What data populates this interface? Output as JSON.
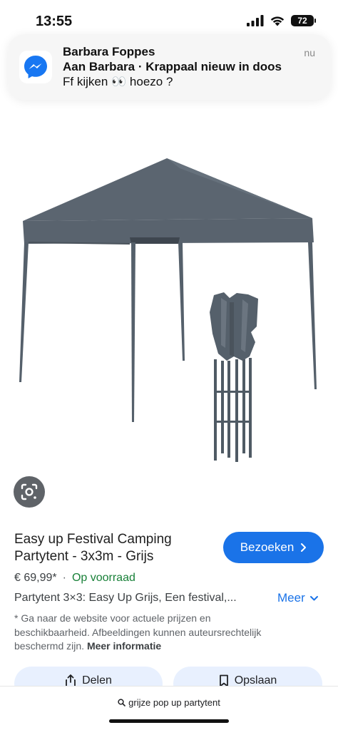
{
  "status_bar": {
    "time": "13:55",
    "battery": "72",
    "icons": [
      "signal-icon",
      "wifi-icon",
      "battery-icon"
    ]
  },
  "notification": {
    "app_icon": "messenger-icon",
    "sender": "Barbara Foppes",
    "subtitle": "Aan Barbara · Krappaal nieuw in doos",
    "message": "Ff kijken 👀 hoezo ?",
    "time": "nu"
  },
  "image": {
    "lens_icon": "google-lens-icon"
  },
  "product": {
    "title": "Easy up Festival Camping Partytent - 3x3m - Grijs",
    "visit_label": "Bezoeken",
    "price": "€ 69,99*",
    "separator": "·",
    "stock": "Op voorraad",
    "description": "Partytent 3×3: Easy Up Grijs, Een festival,...",
    "more_label": "Meer",
    "disclaimer": "* Ga naar de website voor actuele prijzen en beschikbaarheid. Afbeeldingen kunnen auteursrechtelijk beschermd zijn.",
    "more_info_label": "Meer informatie"
  },
  "actions": {
    "share_label": "Delen",
    "save_label": "Opslaan"
  },
  "search": {
    "query": "grijze pop up partytent"
  },
  "colors": {
    "accent": "#1a73e8",
    "stock_green": "#188038",
    "tent_gray": "#5b6570"
  }
}
